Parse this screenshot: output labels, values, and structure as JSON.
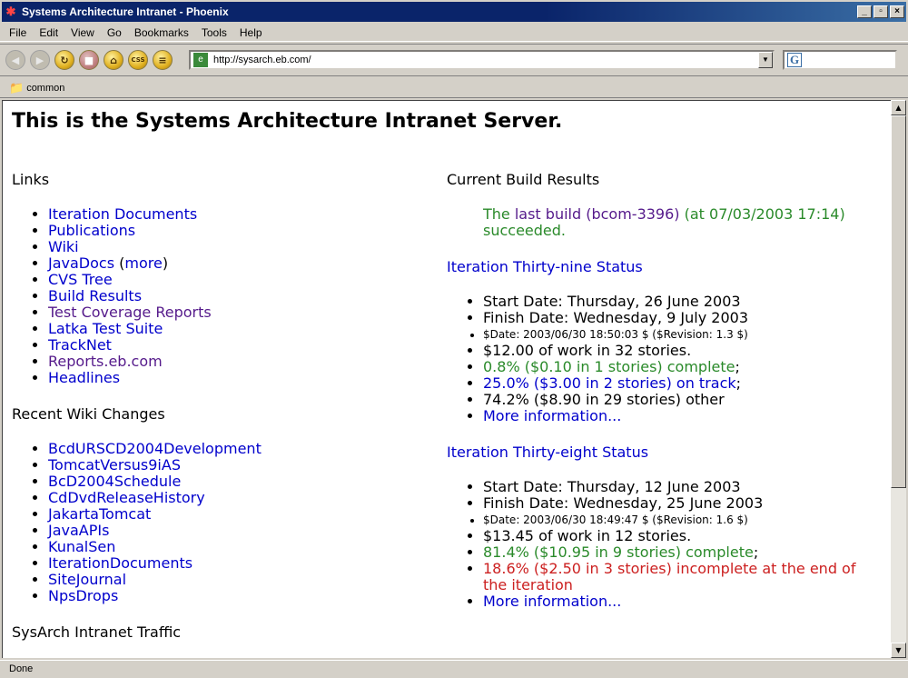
{
  "window": {
    "title": "Systems Architecture Intranet - Phoenix",
    "buttons": [
      "_",
      "▫",
      "×"
    ]
  },
  "menu": [
    "File",
    "Edit",
    "View",
    "Go",
    "Bookmarks",
    "Tools",
    "Help"
  ],
  "toolbar": {
    "url": "http://sysarch.eb.com/",
    "css_label": "CSS",
    "search_placeholder": ""
  },
  "bookmarks_bar": {
    "item": "common"
  },
  "page": {
    "heading": "This is the Systems Architecture Intranet Server.",
    "links": {
      "title": "Links",
      "items": [
        {
          "text": "Iteration Documents",
          "visited": false
        },
        {
          "text": "Publications",
          "visited": false
        },
        {
          "text": "Wiki",
          "visited": false
        },
        {
          "text": "JavaDocs",
          "visited": false,
          "extra_pre": " (",
          "extra_link": "more",
          "extra_post": ")"
        },
        {
          "text": "CVS Tree",
          "visited": false
        },
        {
          "text": "Build Results",
          "visited": false
        },
        {
          "text": "Test Coverage Reports",
          "visited": true
        },
        {
          "text": "Latka Test Suite",
          "visited": false
        },
        {
          "text": "TrackNet",
          "visited": false
        },
        {
          "text": "Reports.eb.com",
          "visited": true
        },
        {
          "text": "Headlines",
          "visited": false
        }
      ]
    },
    "wiki": {
      "title": "Recent Wiki Changes",
      "items": [
        "BcdURSCD2004Development",
        "TomcatVersus9iAS",
        "BcD2004Schedule",
        "CdDvdReleaseHistory",
        "JakartaTomcat",
        "JavaAPIs",
        "KunalSen",
        "IterationDocuments",
        "SiteJournal",
        "NpsDrops"
      ]
    },
    "traffic": {
      "title": "SysArch Intranet Traffic"
    },
    "build": {
      "title": "Current Build Results",
      "prefix": "The ",
      "link": "last build (bcom-3396)",
      "suffix": " (at 07/03/2003 17:14) succeeded."
    },
    "iter39": {
      "title": "Iteration Thirty-nine Status",
      "start": "Start Date: Thursday, 26 June 2003",
      "finish": "Finish Date: Wednesday, 9 July 2003",
      "rev": "$Date: 2003/06/30 18:50:03 $ ($Revision: 1.3 $)",
      "work": "$12.00 of work in 32 stories.",
      "complete": "0.8% ($0.10 in 1 stories) complete",
      "ontrack": "25.0% ($3.00 in 2 stories) on track",
      "other": "74.2% ($8.90 in 29 stories) other",
      "more": "More information..."
    },
    "iter38": {
      "title": "Iteration Thirty-eight Status",
      "start": "Start Date: Thursday, 12 June 2003",
      "finish": "Finish Date: Wednesday, 25 June 2003",
      "rev": "$Date: 2003/06/30 18:49:47 $ ($Revision: 1.6 $)",
      "work": "$13.45 of work in 12 stories.",
      "complete": "81.4% ($10.95 in 9 stories) complete",
      "incomplete": "18.6% ($2.50 in 3 stories) incomplete at the end of the iteration",
      "more": "More information..."
    }
  },
  "status": "Done"
}
